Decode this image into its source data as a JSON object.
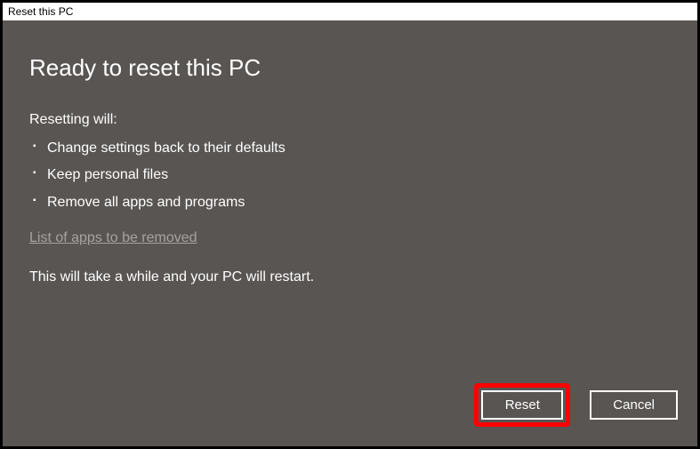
{
  "title": "Reset this PC",
  "heading": "Ready to reset this PC",
  "subheading": "Resetting will:",
  "bullets": [
    "Change settings back to their defaults",
    "Keep personal files",
    "Remove all apps and programs"
  ],
  "link": "List of apps to be removed",
  "notice": "This will take a while and your PC will restart.",
  "buttons": {
    "reset": "Reset",
    "cancel": "Cancel"
  }
}
